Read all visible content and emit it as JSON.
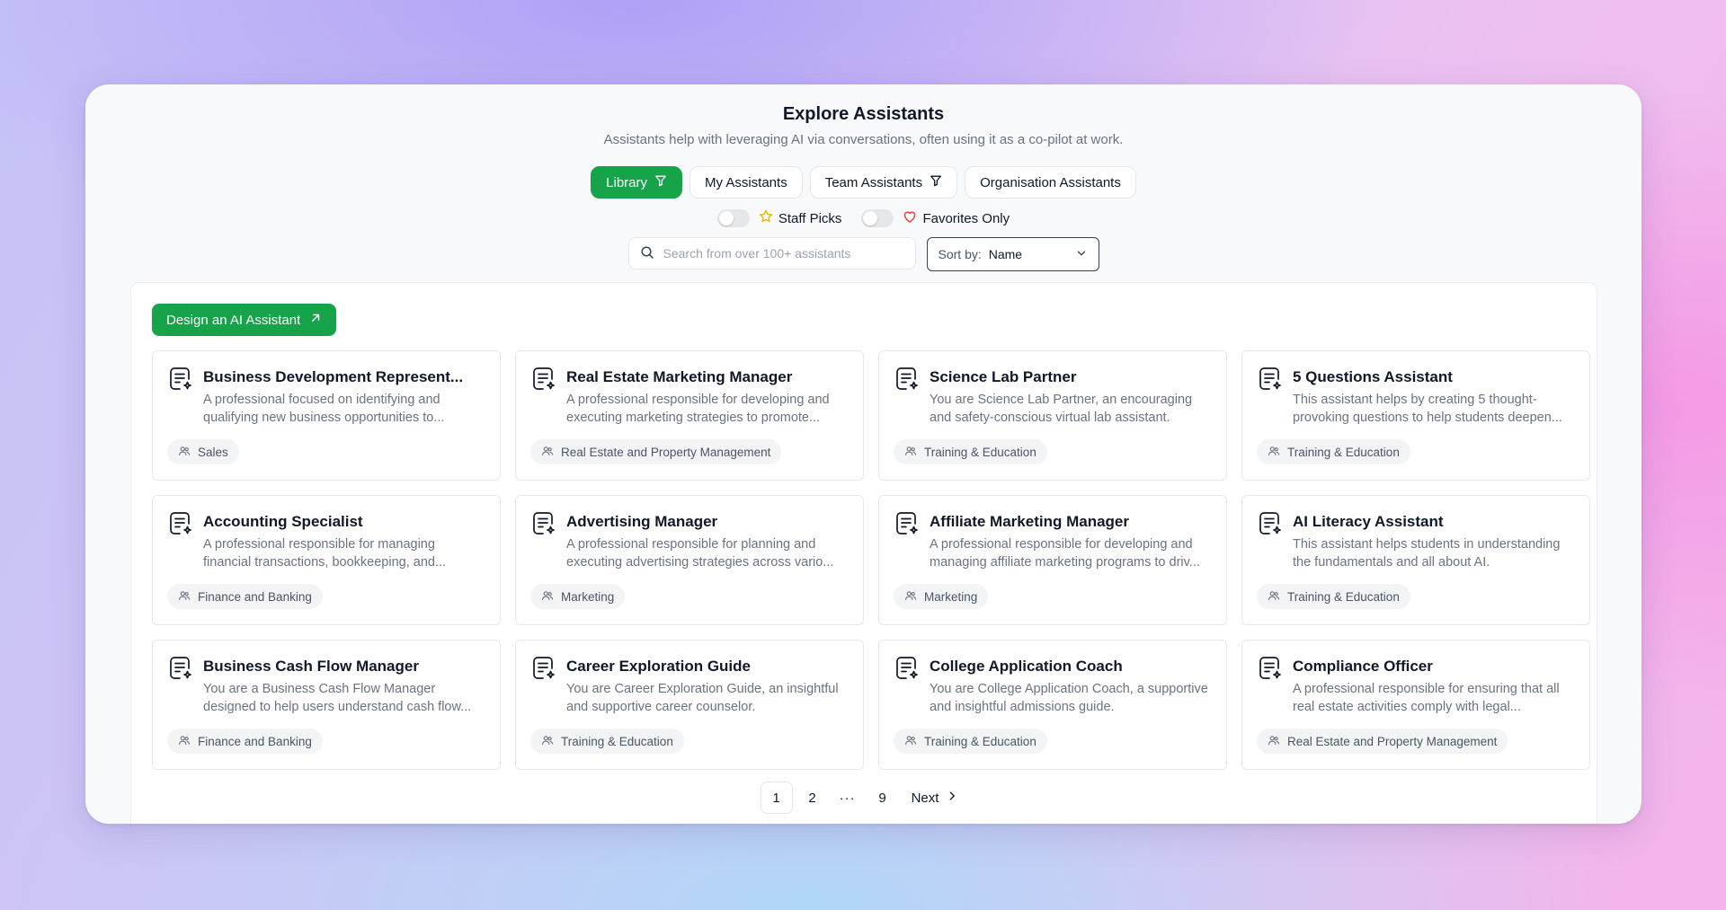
{
  "header": {
    "title": "Explore Assistants",
    "subtitle": "Assistants help with leveraging AI via conversations, often using it as a co-pilot at work."
  },
  "tabs": [
    {
      "label": "Library",
      "active": true,
      "filter_icon": true
    },
    {
      "label": "My Assistants",
      "active": false,
      "filter_icon": false
    },
    {
      "label": "Team Assistants",
      "active": false,
      "filter_icon": true
    },
    {
      "label": "Organisation Assistants",
      "active": false,
      "filter_icon": false
    }
  ],
  "toggles": {
    "staff_picks": {
      "label": "Staff Picks",
      "on": false
    },
    "favorites": {
      "label": "Favorites Only",
      "on": false
    }
  },
  "search": {
    "placeholder": "Search from over 100+ assistants",
    "value": ""
  },
  "sort": {
    "label": "Sort by:",
    "value": "Name"
  },
  "design_button": {
    "label": "Design an AI Assistant"
  },
  "colors": {
    "accent": "#16a34a",
    "star": "#eab308",
    "heart": "#ef4444"
  },
  "cards": [
    {
      "title": "Business Development Represent...",
      "description": "A professional focused on identifying and qualifying new business opportunities to...",
      "category": "Sales"
    },
    {
      "title": "Real Estate Marketing Manager",
      "description": "A professional responsible for developing and executing marketing strategies to promote...",
      "category": "Real Estate and Property Management"
    },
    {
      "title": "Science Lab Partner",
      "description": "You are Science Lab Partner, an encouraging and safety-conscious virtual lab assistant.",
      "category": "Training & Education"
    },
    {
      "title": "5 Questions Assistant",
      "description": "This assistant helps by creating 5 thought-provoking questions to help students deepen...",
      "category": "Training & Education"
    },
    {
      "title": "Accounting Specialist",
      "description": "A professional responsible for managing financial transactions, bookkeeping, and...",
      "category": "Finance and Banking"
    },
    {
      "title": "Advertising Manager",
      "description": "A professional responsible for planning and executing advertising strategies across vario...",
      "category": "Marketing"
    },
    {
      "title": "Affiliate Marketing Manager",
      "description": "A professional responsible for developing and managing affiliate marketing programs to driv...",
      "category": "Marketing"
    },
    {
      "title": "AI Literacy Assistant",
      "description": "This assistant helps students in understanding the fundamentals and all about AI.",
      "category": "Training & Education"
    },
    {
      "title": "Business Cash Flow Manager",
      "description": "You are a Business Cash Flow Manager designed to help users understand cash flow...",
      "category": "Finance and Banking"
    },
    {
      "title": "Career Exploration Guide",
      "description": "You are Career Exploration Guide, an insightful and supportive career counselor.",
      "category": "Training & Education"
    },
    {
      "title": "College Application Coach",
      "description": "You are College Application Coach, a supportive and insightful admissions guide.",
      "category": "Training & Education"
    },
    {
      "title": "Compliance Officer",
      "description": "A professional responsible for ensuring that all real estate activities comply with legal...",
      "category": "Real Estate and Property Management"
    }
  ],
  "pagination": {
    "pages": [
      "1",
      "2"
    ],
    "ellipsis": "···",
    "last": "9",
    "current": "1",
    "next_label": "Next"
  }
}
